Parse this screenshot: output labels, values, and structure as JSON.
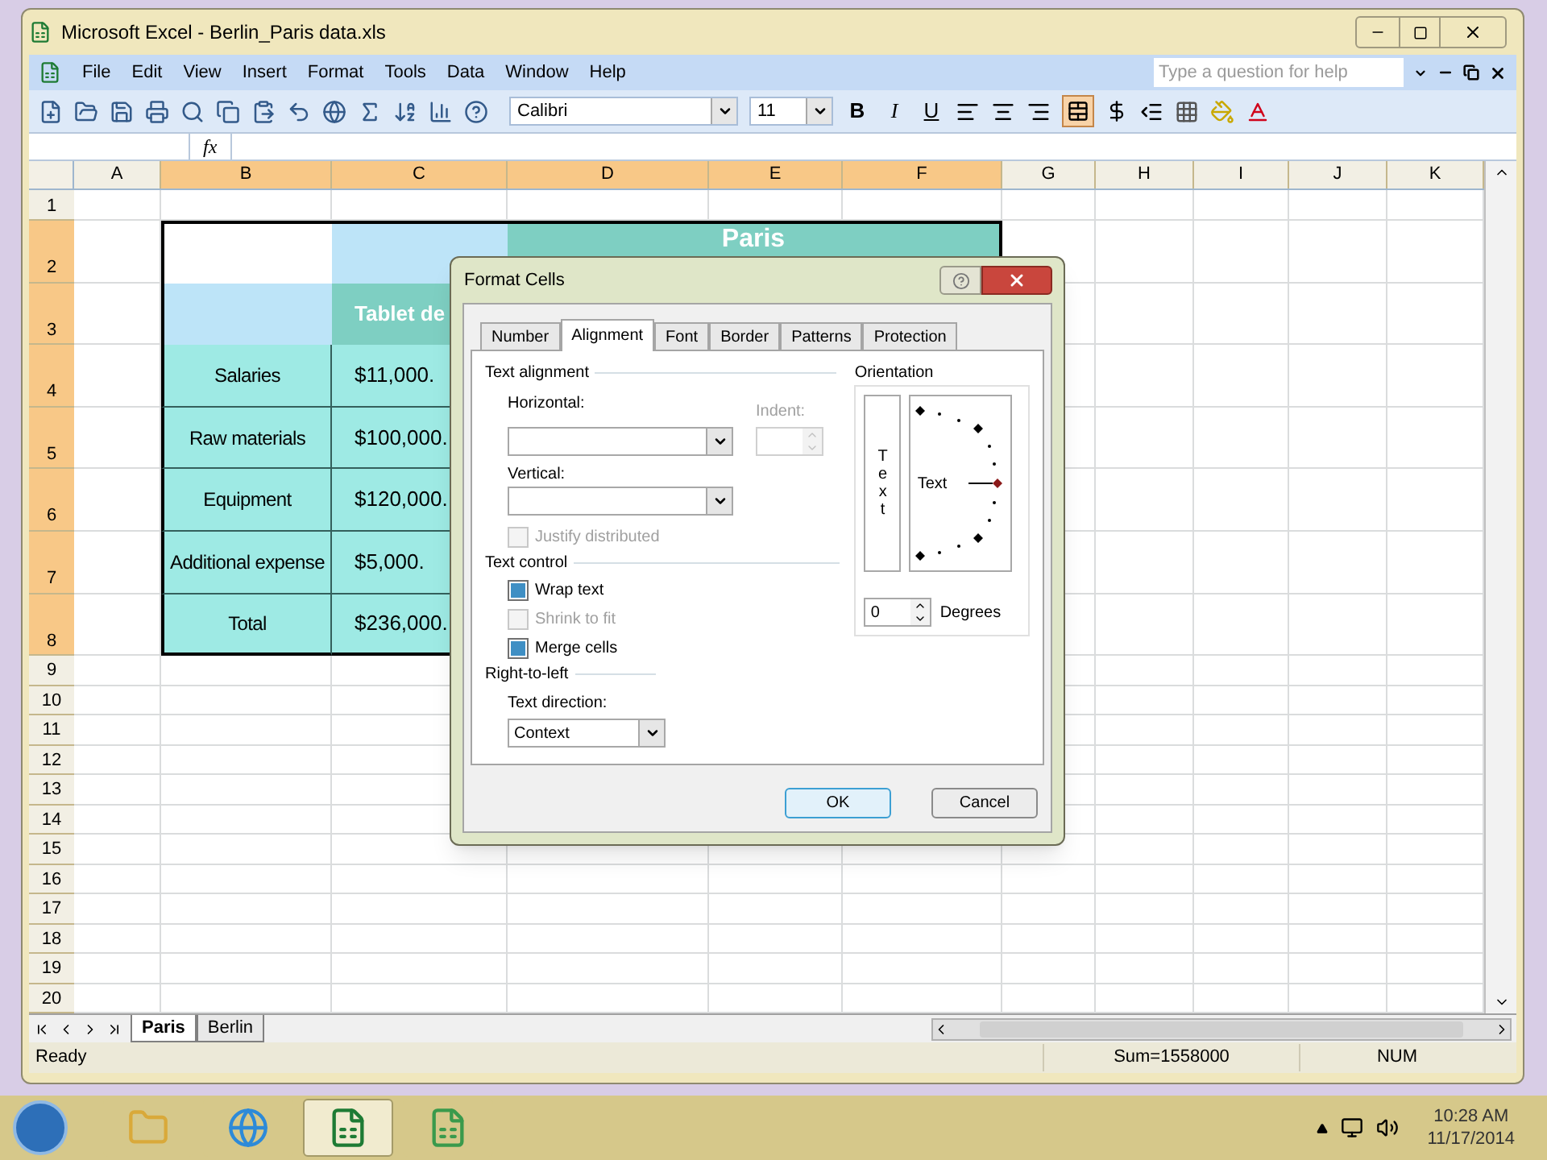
{
  "window": {
    "title": "Microsoft Excel - Berlin_Paris data.xls"
  },
  "menu": [
    "File",
    "Edit",
    "View",
    "Insert",
    "Format",
    "Tools",
    "Data",
    "Window",
    "Help"
  ],
  "help_box": {
    "placeholder": "Type a question for help"
  },
  "toolbar": {
    "font": "Calibri",
    "size": "11",
    "format_buttons": [
      {
        "label": "B",
        "kind": "bold"
      },
      {
        "label": "I",
        "kind": "italic"
      },
      {
        "label": "U",
        "kind": "underline"
      }
    ],
    "merge_center": {
      "selected": true
    }
  },
  "formula_bar": {
    "function_label": "fx"
  },
  "sheet": {
    "columns": [
      "A",
      "B",
      "C",
      "D",
      "E",
      "F",
      "G",
      "H",
      "I",
      "J",
      "K"
    ],
    "row_numbers": [
      "1",
      "2",
      "3",
      "4",
      "5",
      "6",
      "7",
      "8",
      "9",
      "10",
      "11",
      "12",
      "13",
      "14",
      "15",
      "16",
      "17",
      "18",
      "19",
      "20"
    ],
    "table": {
      "title": "Paris",
      "column_header": "Tablet de",
      "rows": [
        {
          "label": "Salaries",
          "value": "$11,000."
        },
        {
          "label": "Raw materials",
          "value": "$100,000."
        },
        {
          "label": "Equipment",
          "value": "$120,000."
        },
        {
          "label": "Additional expense",
          "value": "$5,000."
        },
        {
          "label": "Total",
          "value": "$236,000."
        }
      ]
    }
  },
  "dialog": {
    "title": "Format Cells",
    "tabs": [
      {
        "label": "Number",
        "selected": false
      },
      {
        "label": "Alignment",
        "selected": true
      },
      {
        "label": "Font",
        "selected": false
      },
      {
        "label": "Border",
        "selected": false
      },
      {
        "label": "Patterns",
        "selected": false
      },
      {
        "label": "Protection",
        "selected": false
      }
    ],
    "text_alignment": {
      "heading": "Text alignment",
      "horizontal_label": "Horizontal:",
      "vertical_label": "Vertical:",
      "indent_label": "Indent:",
      "justify": {
        "label": "Justify distributed",
        "checked": false,
        "disabled": true
      }
    },
    "text_control": {
      "heading": "Text control",
      "options": [
        {
          "label": "Wrap text",
          "checked": true,
          "disabled": false
        },
        {
          "label": "Shrink to fit",
          "checked": false,
          "disabled": true
        },
        {
          "label": "Merge cells",
          "checked": true,
          "disabled": false
        }
      ]
    },
    "right_to_left": {
      "heading": "Right-to-left",
      "direction_label": "Text direction:",
      "direction_value": "Context"
    },
    "orientation": {
      "heading": "Orientation",
      "vertical_text": "Text",
      "dial_text": "Text",
      "degrees_value": "0",
      "degrees_label": "Degrees"
    },
    "buttons": [
      {
        "label": "OK",
        "default": true
      },
      {
        "label": "Cancel",
        "default": false
      }
    ]
  },
  "sheet_tabs": [
    {
      "label": "Paris",
      "selected": true
    },
    {
      "label": "Berlin",
      "selected": false
    }
  ],
  "status_bar": {
    "mode": "Ready",
    "sum": "Sum=1558000",
    "num": "NUM"
  },
  "taskbar": {
    "items": [
      {
        "kind": "folder",
        "selected": false
      },
      {
        "kind": "browser",
        "selected": false
      },
      {
        "kind": "excel",
        "selected": true
      },
      {
        "kind": "workbook",
        "selected": false
      }
    ],
    "time": "10:28 AM",
    "date": "11/17/2014"
  }
}
